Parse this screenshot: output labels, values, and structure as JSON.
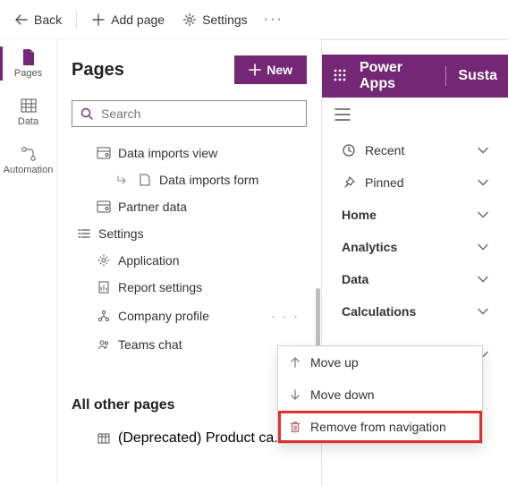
{
  "topbar": {
    "back": "Back",
    "add_page": "Add page",
    "settings": "Settings"
  },
  "rail": {
    "pages": "Pages",
    "data": "Data",
    "automation": "Automation"
  },
  "pages_panel": {
    "title": "Pages",
    "new_button": "New",
    "search_placeholder": "Search",
    "tree": {
      "data_imports_view": "Data imports view",
      "data_imports_form": "Data imports form",
      "partner_data": "Partner data",
      "settings": "Settings",
      "application": "Application",
      "report_settings": "Report settings",
      "company_profile": "Company profile",
      "teams_chat": "Teams chat"
    },
    "all_other": {
      "title": "All other pages",
      "deprecated_product": "(Deprecated) Product ca..."
    }
  },
  "context_menu": {
    "move_up": "Move up",
    "move_down": "Move down",
    "remove": "Remove from navigation"
  },
  "app_preview": {
    "brand": "Power Apps",
    "app_name": "Susta",
    "nav": {
      "recent": "Recent",
      "pinned": "Pinned",
      "home": "Home",
      "analytics": "Analytics",
      "data": "Data",
      "calculations": "Calculations"
    }
  },
  "colors": {
    "accent": "#742774",
    "highlight": "#e03030"
  }
}
